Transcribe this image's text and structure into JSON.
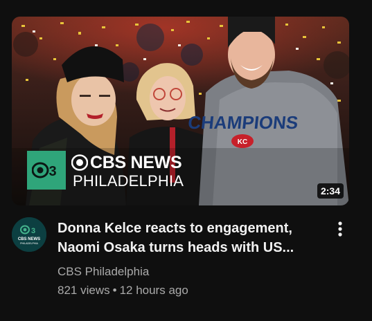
{
  "thumbnail": {
    "logo_icon": "cbs-eye-3-icon",
    "network_name": "CBS NEWS",
    "network_city": "PHILADELPHIA",
    "duration": "2:34",
    "shirt_text": "CHAMPIONS",
    "accent_color": "#2fa57a"
  },
  "video": {
    "title_line1": "Donna Kelce reacts to engagement,",
    "title_line2": "Naomi Osaka turns heads with US...",
    "channel": "CBS Philadelphia",
    "views": "821 views",
    "separator": "•",
    "age": "12 hours ago"
  },
  "avatar": {
    "icon": "cbs-news-philadelphia-avatar-icon",
    "text": "CBS NEWS",
    "subtext": "PHILADELPHIA"
  },
  "menu": {
    "icon": "more-vertical-icon"
  },
  "colors": {
    "background": "#0f0f0f",
    "title_text": "#f1f1f1",
    "secondary_text": "#aaaaaa"
  }
}
